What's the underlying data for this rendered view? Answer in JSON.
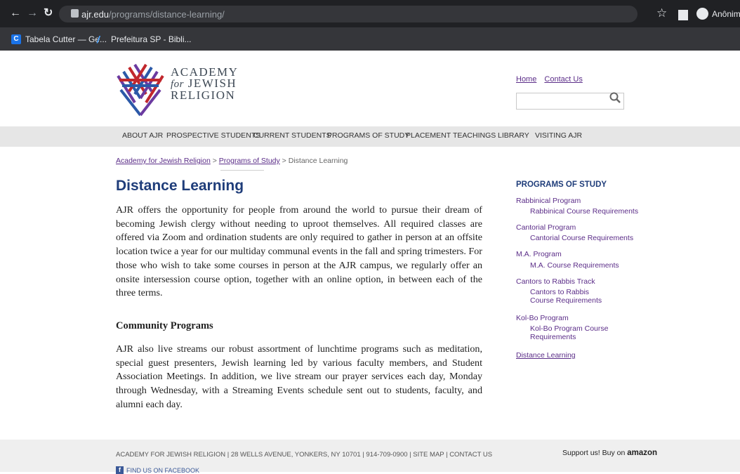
{
  "browser": {
    "url_host": "ajr.edu",
    "url_path": "/programs/distance-learning/",
    "profile_label": "Anônima",
    "bookmarks": [
      "Tabela Cutter — Ge...",
      "Prefeitura SP - Bibli..."
    ]
  },
  "site": {
    "logo_line1": "ACADEMY",
    "logo_line2_for": "for",
    "logo_line2": "JEWISH",
    "logo_line3": "RELIGION",
    "util_links": [
      "Home",
      "Contact Us"
    ],
    "nav": [
      "ABOUT AJR",
      "PROSPECTIVE STUDENTS",
      "CURRENT STUDENTS",
      "PROGRAMS OF STUDY",
      "PLACEMENT",
      "TEACHINGS",
      "LIBRARY",
      "VISITING AJR"
    ]
  },
  "breadcrumb": {
    "items": [
      "Academy for Jewish Religion",
      "Programs of Study"
    ],
    "separator": ">",
    "current": "Distance Learning"
  },
  "main": {
    "title": "Distance Learning",
    "paragraph1": "AJR offers the opportunity for people from around the world to pursue their dream of becoming Jewish clergy without needing to uproot themselves. All required classes are offered via Zoom and ordination students are only required to gather in person at an offsite location twice a year for our multiday communal events in the fall and spring trimesters. For those who wish to take some courses in person at the AJR campus, we regularly offer an onsite intersession course option, together with an online option, in between each of the three terms.",
    "subhead": "Community Programs",
    "paragraph2": "AJR also live streams our robust assortment of lunchtime programs such as meditation, special guest presenters, Jewish learning led by various faculty members, and Student Association Meetings. In addition, we live stream our prayer services each day, Monday through Wednesday, with a Streaming Events schedule sent out to students, faculty, and alumni each day."
  },
  "sidebar": {
    "title": "PROGRAMS OF STUDY",
    "items": [
      {
        "label": "Rabbinical Program",
        "sub": "Rabbinical Course Requirements"
      },
      {
        "label": "Cantorial Program",
        "sub": "Cantorial Course Requirements"
      },
      {
        "label": "M.A. Program",
        "sub": "M.A. Course Requirements"
      },
      {
        "label": "Cantors to Rabbis Track",
        "sub": "Cantors to Rabbis Course Requirements"
      },
      {
        "label": "Kol-Bo Program",
        "sub": "Kol-Bo Program Course Requirements"
      },
      {
        "label": "Distance Learning",
        "sub": ""
      }
    ]
  },
  "footer": {
    "text": "ACADEMY FOR JEWISH RELIGION  |  28 WELLS AVENUE, YONKERS, NY 10701  |  914-709-0900  |  SITE MAP  |  CONTACT US",
    "support_prefix": "Support us! Buy on",
    "support_brand": "amazon",
    "facebook": "FIND US ON FACEBOOK"
  },
  "colors": {
    "link": "#5b2d88",
    "title": "#1f3d7a",
    "nav_bg": "#e6e6e6",
    "logo_purple": "#6b3aa0",
    "logo_red": "#c1272d",
    "logo_blue": "#2b59a8"
  }
}
